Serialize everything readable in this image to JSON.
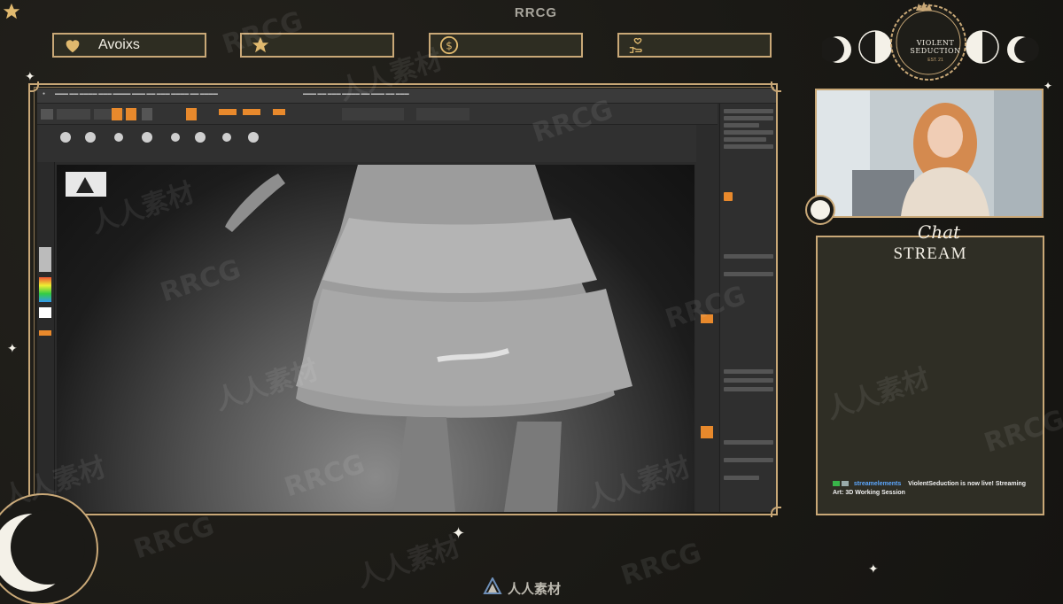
{
  "brand": "RRCG",
  "stats": [
    {
      "icon": "heart-icon",
      "label": "Avoixs"
    },
    {
      "icon": "star-icon",
      "label": ""
    },
    {
      "icon": "dollar-coin-icon",
      "label": ""
    },
    {
      "icon": "hand-heart-icon",
      "label": ""
    }
  ],
  "logo": {
    "line1": "VIOLENT SEDUCTION",
    "line2": "EST. 21"
  },
  "chat": {
    "script_title": "Chat",
    "title": "STREAM",
    "message": {
      "user": "streamelements",
      "text": "ViolentSeduction is now live! Streaming Art: 3D Working Session"
    }
  },
  "watermark": {
    "latin": "RRCG",
    "cjk": "人人素材"
  },
  "bottom_logo": "人人素材",
  "colors": {
    "gold": "#c9a877",
    "panel": "#2e2d22",
    "bg": "#1b1a17",
    "zbrush_orange": "#e8892c"
  }
}
